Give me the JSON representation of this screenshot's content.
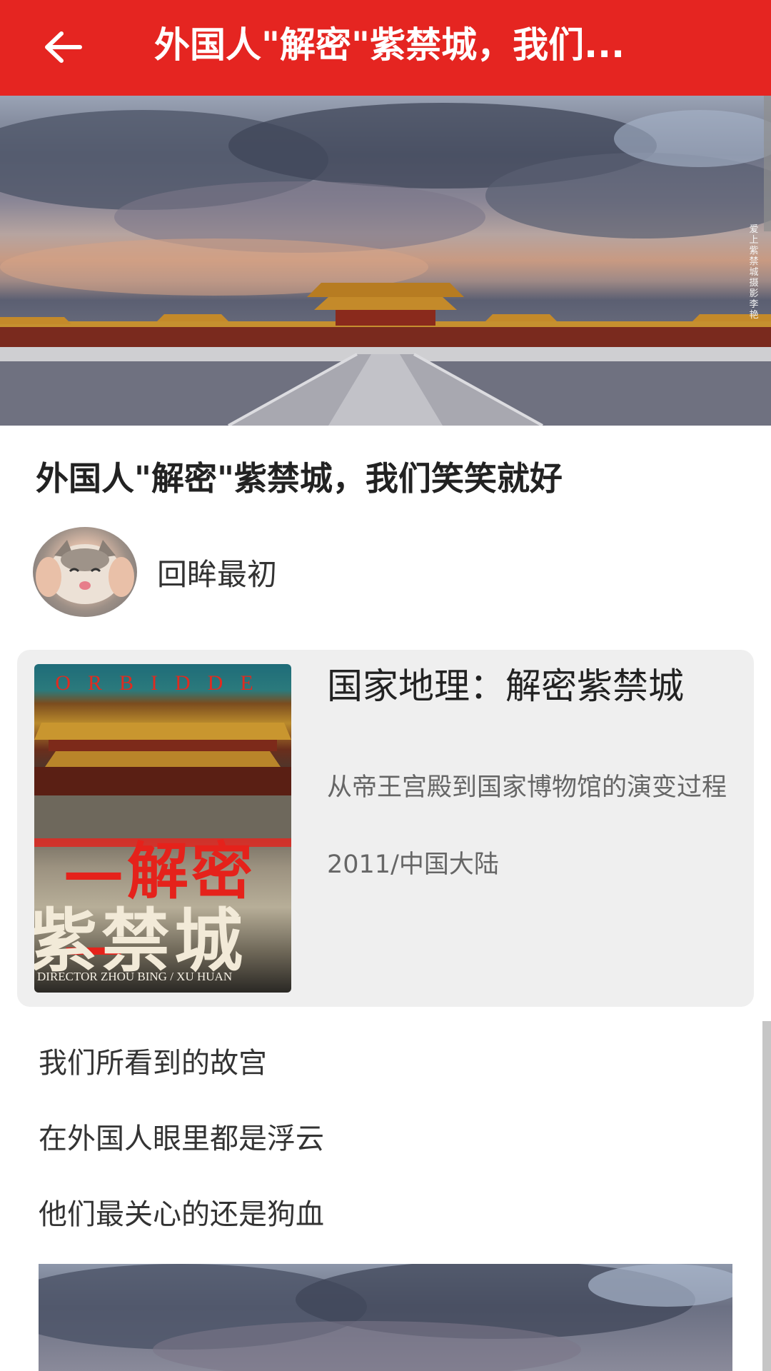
{
  "app_bar": {
    "title": "外国人\"解密\"紫禁城，我们...",
    "back_icon": "arrow-left-icon",
    "background_color": "#e52521"
  },
  "hero": {
    "image": "forbidden-city-panorama-photo",
    "watermark": "爱上紫禁城 摄影 李艳"
  },
  "article": {
    "title": "外国人\"解密\"紫禁城，我们笑笑就好",
    "author": {
      "name": "回眸最初",
      "avatar": "cat-avatar-image"
    }
  },
  "media_card": {
    "poster": {
      "top_text": "ORBIDDE",
      "big_red_text": "—解密—",
      "big_beige_text": "紫禁城",
      "credit": "DIRECTOR  ZHOU BING / XU HUAN"
    },
    "title": "国家地理：解密紫禁城",
    "subtitle": "从帝王宫殿到国家博物馆的演变过程",
    "meta": "2011/中国大陆"
  },
  "body": {
    "lines": [
      "我们所看到的故宫",
      "在外国人眼里都是浮云",
      "他们最关心的还是狗血"
    ]
  },
  "bottom_image": "forbidden-city-sky-photo"
}
